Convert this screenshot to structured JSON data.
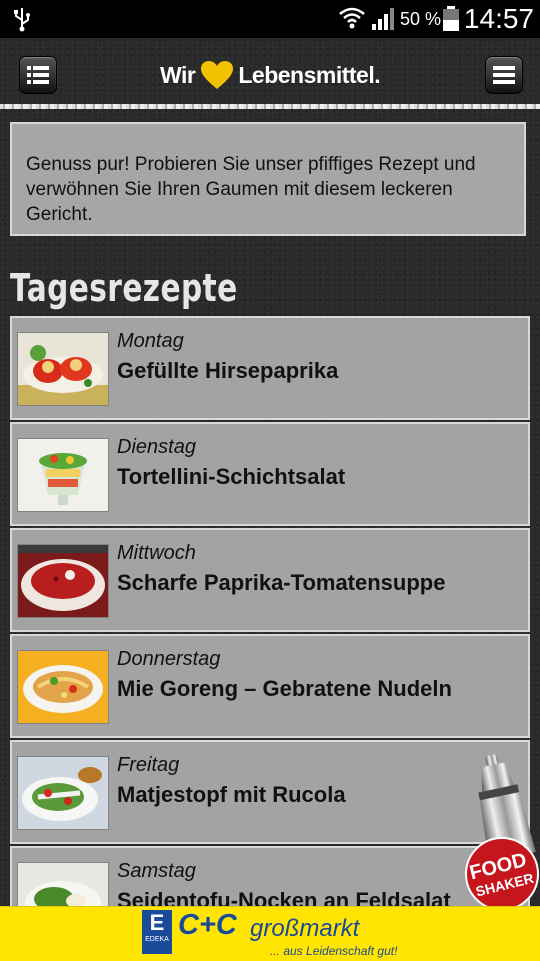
{
  "status_bar": {
    "battery_percent": "50 %",
    "time": "14:57"
  },
  "header": {
    "logo_left": "Wir",
    "logo_right": "Lebensmittel.",
    "heart_color": "#f2c200"
  },
  "intro": {
    "text": "Genuss pur! Probieren Sie unser pfiffiges Rezept und verwöhnen Sie Ihren Gaumen mit diesem leckeren Gericht."
  },
  "section": {
    "title": "Tagesrezepte"
  },
  "recipes": [
    {
      "day": "Montag",
      "title": "Gefüllte Hirsepaprika"
    },
    {
      "day": "Dienstag",
      "title": "Tortellini-Schichtsalat"
    },
    {
      "day": "Mittwoch",
      "title": "Scharfe Paprika-Tomatensuppe"
    },
    {
      "day": "Donnerstag",
      "title": "Mie Goreng – Gebratene Nudeln"
    },
    {
      "day": "Freitag",
      "title": "Matjestopf mit Rucola"
    },
    {
      "day": "Samstag",
      "title": "Seidentofu-Nocken an Feldsalat"
    }
  ],
  "food_shaker": {
    "line1": "FOOD",
    "line2": "SHAKER"
  },
  "ad": {
    "brand_e": "E",
    "brand_sub": "EDEKA",
    "brand_cc": "C+C",
    "brand_name": "großmarkt",
    "slogan": "... aus Leidenschaft gut!"
  },
  "icons": [
    "usb-icon",
    "wifi-icon",
    "signal-icon",
    "battery-icon",
    "list-menu-icon",
    "hamburger-menu-icon",
    "heart-icon"
  ]
}
